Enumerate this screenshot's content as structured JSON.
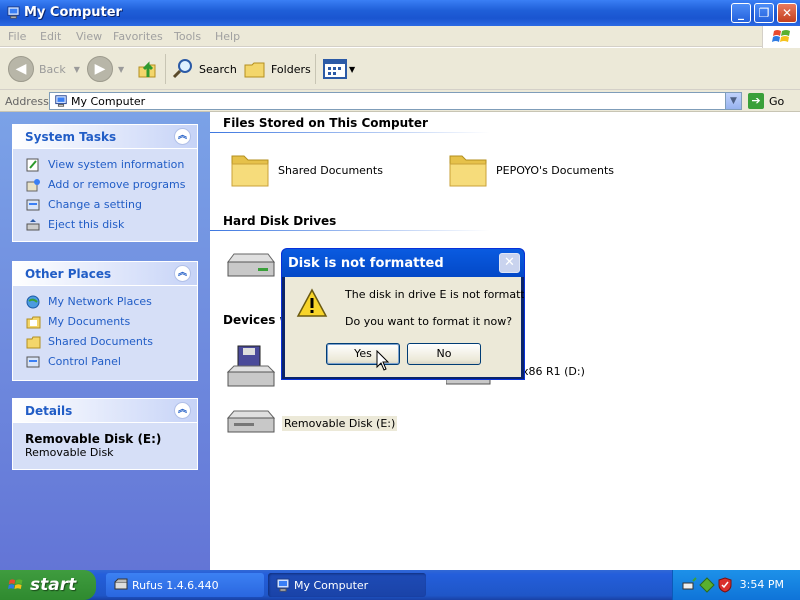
{
  "window": {
    "title": "My Computer"
  },
  "menu": [
    "File",
    "Edit",
    "View",
    "Favorites",
    "Tools",
    "Help"
  ],
  "toolbar": {
    "back": "Back",
    "search": "Search",
    "folders": "Folders"
  },
  "address": {
    "label": "Address",
    "value": "My Computer",
    "go": "Go"
  },
  "system_tasks": {
    "title": "System Tasks",
    "items": [
      "View system information",
      "Add or remove programs",
      "Change a setting",
      "Eject this disk"
    ]
  },
  "other_places": {
    "title": "Other Places",
    "items": [
      "My Network Places",
      "My Documents",
      "Shared Documents",
      "Control Panel"
    ]
  },
  "details": {
    "title": "Details",
    "name": "Removable Disk (E:)",
    "type": "Removable Disk"
  },
  "sections": {
    "files": "Files Stored on This Computer",
    "hdd": "Hard Disk Drives",
    "removable": "Devices wi"
  },
  "items": {
    "shared_docs": "Shared Documents",
    "user_docs": "PEPOYO's Documents",
    "cd_drive": "x86 R1 (D:)",
    "removable": "Removable Disk (E:)"
  },
  "dialog": {
    "title": "Disk is not formatted",
    "message1": "The disk in drive E is not formatted.",
    "message2": "Do you want to format it now?",
    "yes": "Yes",
    "no": "No"
  },
  "taskbar": {
    "start": "start",
    "buttons": [
      "Rufus 1.4.6.440",
      "My Computer"
    ],
    "clock": "3:54 PM"
  },
  "colors": {
    "titlebar": "#1f5fd8",
    "taskpane": "#6375d6",
    "link": "#215dc6",
    "start": "#3f9c3f"
  }
}
